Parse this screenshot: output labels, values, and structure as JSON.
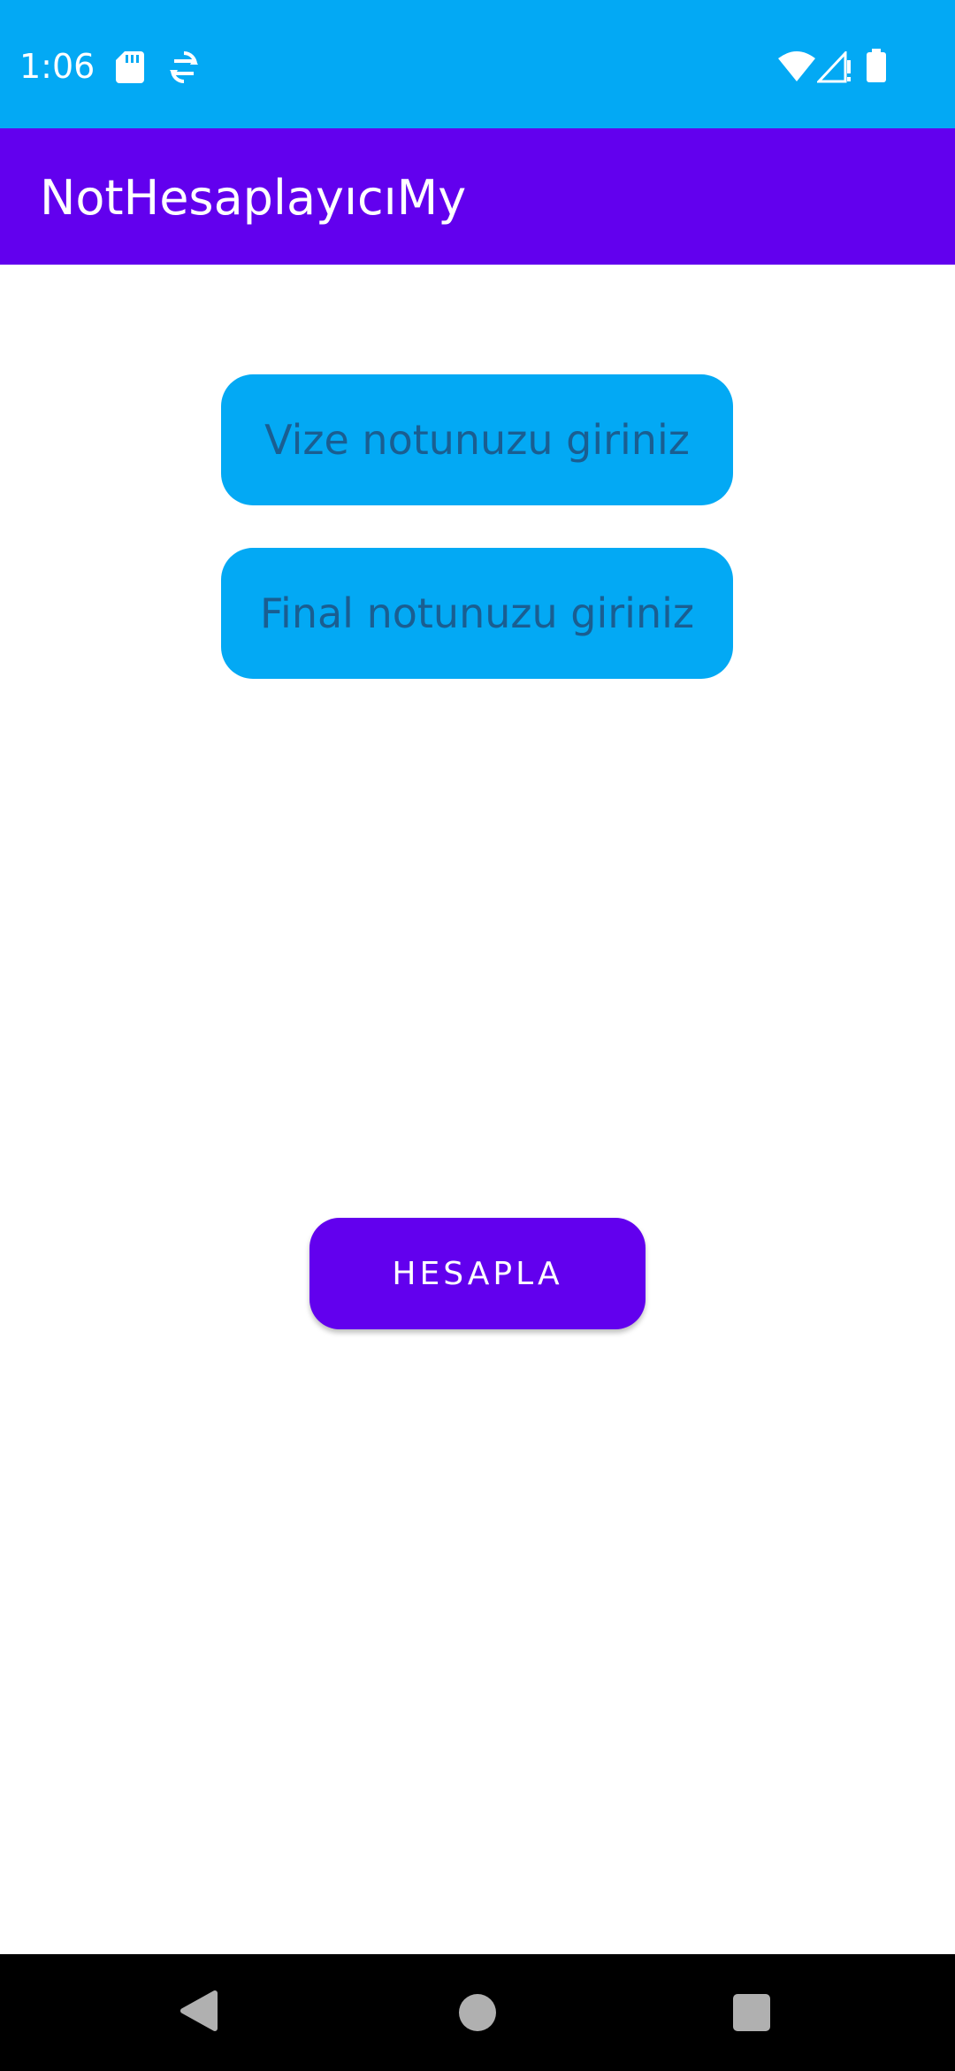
{
  "status_bar": {
    "time": "1:06",
    "background_color": "#03A9F4",
    "icons": [
      "sd-card-icon",
      "sync-icon",
      "wifi-icon",
      "cellular-signal-icon",
      "battery-icon"
    ]
  },
  "app_bar": {
    "title": "NotHesaplayıcıMy",
    "background_color": "#6200EE"
  },
  "form": {
    "midterm_input": {
      "placeholder": "Vize notunuzu giriniz",
      "value": ""
    },
    "final_input": {
      "placeholder": "Final notunuzu giriniz",
      "value": ""
    },
    "input_background_color": "#03A9F4",
    "calculate_button": {
      "label": "HESAPLA",
      "background_color": "#6200EE"
    }
  },
  "nav_bar": {
    "icons": [
      "back-icon",
      "home-icon",
      "recents-icon"
    ]
  }
}
